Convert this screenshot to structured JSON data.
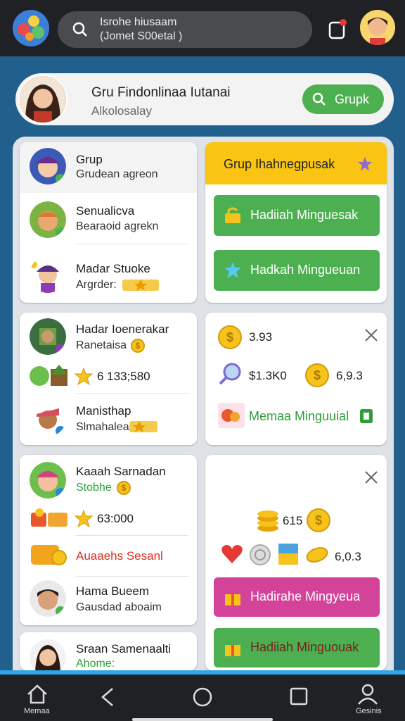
{
  "header": {
    "search_line1": "Isrohe hiusaam",
    "search_line2": "(Jomet S00etal )"
  },
  "profile": {
    "name": "Gru Findonlinaa Iutanai",
    "subtitle": "Alkolosalay",
    "button_label": "Grupk"
  },
  "left_card_1": {
    "items": [
      {
        "title": "Grup",
        "subtitle": "Grudean agreon"
      },
      {
        "title": "Senualicva",
        "subtitle": "Bearaoid agrekn"
      },
      {
        "title": "Madar Stuoke",
        "subtitle": "Argrder:"
      }
    ]
  },
  "left_card_2": {
    "items": [
      {
        "title": "Hadar Ioenerakar",
        "subtitle": "Ranetaisa"
      },
      {
        "value": "6 133;580"
      },
      {
        "title": "Manisthap",
        "subtitle": "Slmahalea"
      }
    ]
  },
  "left_card_3": {
    "items": [
      {
        "title": "Kaaah Sarnadan",
        "subtitle": "Stobhe"
      },
      {
        "value": "63:000"
      },
      {
        "title": "Auaaehs Sesanl"
      },
      {
        "title": "Hama Bueem",
        "subtitle": "Gausdad aboaim"
      }
    ]
  },
  "left_card_4": {
    "title": "Sraan Samenaalti",
    "subtitle": "Ahome:"
  },
  "right_card_1": {
    "header": "Grup Ihahnegpusak",
    "btn1": "Hadiiah Minguesak",
    "btn2": "Hadkah Mingueuan"
  },
  "right_card_2": {
    "value1": "3.93",
    "value2": "$1.3K0",
    "value3": "6,9.3",
    "link": "Memaa Minguuial"
  },
  "right_card_3": {
    "value1": "615",
    "value2": "6,0.3",
    "btn1": "Hadirahe Mingyeua",
    "btn2": "Hadiiah Minguouak"
  },
  "navbar": {
    "home_label": "Memaa",
    "account_label": "Gesinis"
  },
  "colors": {
    "header_bg": "#202124",
    "body_bg": "#215f8d",
    "accent_green": "#4caf50",
    "accent_yellow": "#f9c512",
    "accent_pink": "#d4439a",
    "nav_accent": "#2fa4e7"
  }
}
